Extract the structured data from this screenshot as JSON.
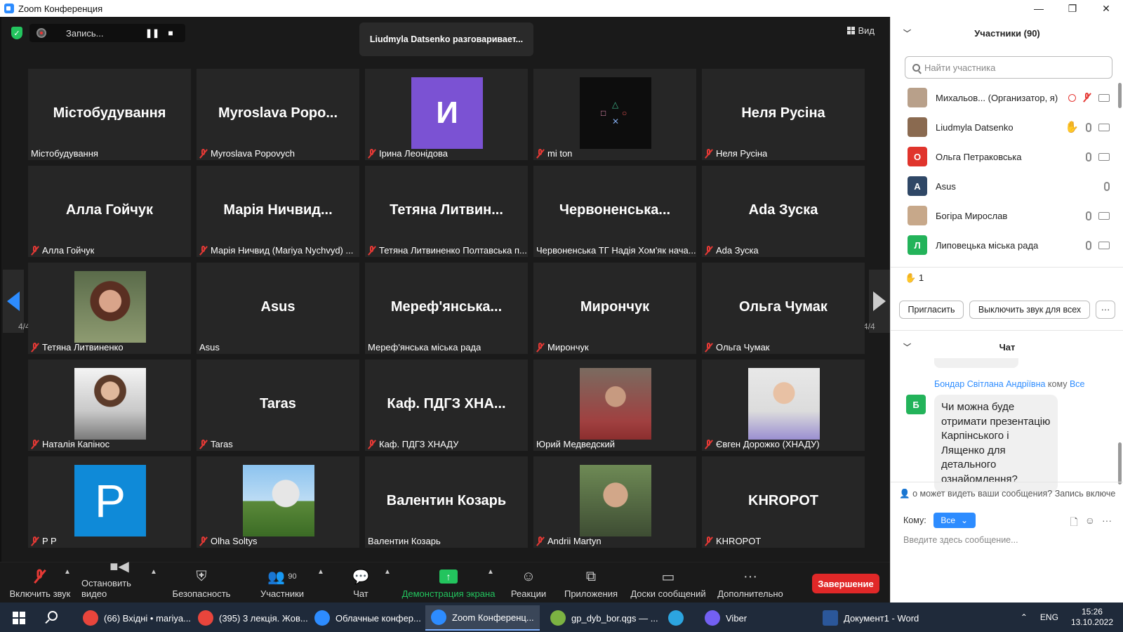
{
  "window": {
    "title": "Zoom Конференция",
    "minimize": "—",
    "restore": "❐",
    "close": "✕"
  },
  "meeting": {
    "recording_label": "Запись...",
    "pause": "❚❚",
    "stop": "■",
    "speaking_banner": "Liudmyla Datsenko разговаривает...",
    "view_label": "Вид",
    "page_left": "4/4",
    "page_right": "4/4",
    "tiles": [
      {
        "big": "Містобудування",
        "label": "Містобудування",
        "muted": false
      },
      {
        "big": "Myroslava  Popo...",
        "label": "Myroslava Popovych",
        "muted": true
      },
      {
        "avatar_letter": "И",
        "label": "Ірина Леонідова",
        "muted": true
      },
      {
        "label": "mi ton",
        "muted": true
      },
      {
        "big": "Неля Русіна",
        "label": "Неля Русіна",
        "muted": true
      },
      {
        "big": "Алла Гойчук",
        "label": "Алла Гойчук",
        "muted": true
      },
      {
        "big": "Марія  Ничвид...",
        "label": "Марія Ничвид (Mariya Nychvyd) ...",
        "muted": true
      },
      {
        "big": "Тетяна  Литвин...",
        "label": "Тетяна Литвиненко Полтавська п...",
        "muted": true
      },
      {
        "big": "Червоненська...",
        "label": "Червоненська ТГ Надія Хом'як нача...",
        "muted": false
      },
      {
        "big": "Ada Зуска",
        "label": "Ada Зуска",
        "muted": true
      },
      {
        "label": "Тетяна Литвиненко",
        "muted": true
      },
      {
        "big": "Asus",
        "label": "Asus",
        "muted": false
      },
      {
        "big": "Мереф'янська...",
        "label": "Мереф'янська міська рада",
        "muted": false
      },
      {
        "big": "Мирончук",
        "label": "Мирончук",
        "muted": true
      },
      {
        "big": "Ольга Чумак",
        "label": "Ольга Чумак",
        "muted": true
      },
      {
        "label": "Наталія Капінос",
        "muted": true
      },
      {
        "big": "Taras",
        "label": "Taras",
        "muted": true
      },
      {
        "big": "Каф.  ПДГЗ  ХНА...",
        "label": "Каф. ПДГЗ ХНАДУ",
        "muted": true
      },
      {
        "label": "Юрий Медведский",
        "muted": false
      },
      {
        "label": "Євген Дорожко (ХНАДУ)",
        "muted": true
      },
      {
        "avatar_letter": "P",
        "label": "P P",
        "muted": true
      },
      {
        "label": "Olha Soltys",
        "muted": true
      },
      {
        "big": "Валентин Козарь",
        "label": "Валентин Козарь",
        "muted": false
      },
      {
        "label": "Andrii Martyn",
        "muted": true
      },
      {
        "big": "KHROPOT",
        "label": "KHROPOT",
        "muted": true
      }
    ]
  },
  "toolbar": {
    "unmute": "Включить звук",
    "stop_video": "Остановить видео",
    "security": "Безопасность",
    "participants": "Участники",
    "participants_count": "90",
    "chat": "Чат",
    "share_screen": "Демонстрация экрана",
    "reactions": "Реакции",
    "apps": "Приложения",
    "whiteboards": "Доски сообщений",
    "more": "Дополнительно",
    "end": "Завершение"
  },
  "participants_panel": {
    "title": "Участники (90)",
    "search_placeholder": "Найти участника",
    "list": [
      {
        "initial": "",
        "name": "Михальов...  (Организатор, я)",
        "color": "#b8a08a"
      },
      {
        "initial": "",
        "name": "Liudmyla Datsenko",
        "color": "#8a6a50"
      },
      {
        "initial": "О",
        "name": "Ольга Петраковська",
        "color": "#e0342c"
      },
      {
        "initial": "A",
        "name": "Asus",
        "color": "#2f4766"
      },
      {
        "initial": "",
        "name": "Богіра Мирослав",
        "color": "#c7a88a"
      },
      {
        "initial": "Л",
        "name": "Липовецька міська рада",
        "color": "#23b35a"
      }
    ],
    "raised_hands": "1",
    "invite": "Пригласить",
    "mute_all": "Выключить звук для всех",
    "more": "···"
  },
  "chat_panel": {
    "title": "Чат",
    "sender": "Бондар Світлана Андріївна",
    "to_word": "кому",
    "recipient": "Все",
    "avatar_initial": "Б",
    "message": "Чи можна буде отримати презентацію Карпінського і Лященко для детального ознайомлення?",
    "who_can_see": "о может видеть ваши сообщения? Запись включе",
    "to_label": "Кому:",
    "to_value": "Все",
    "input_placeholder": "Введите здесь сообщение..."
  },
  "taskbar": {
    "tasks": [
      {
        "label": "(66) Вхідні • mariya...",
        "color": "#e8453c"
      },
      {
        "label": "(395) 3 лекція. Жов...",
        "color": "#e8453c"
      },
      {
        "label": "Облачные конфер...",
        "color": "#2d8cff"
      },
      {
        "label": "Zoom Конференц...",
        "color": "#2d8cff"
      },
      {
        "label": "gp_dyb_bor.qgs — ...",
        "color": "#7cb342"
      },
      {
        "label": "",
        "color": "#2ca5e0"
      },
      {
        "label": "Viber",
        "color": "#7360f2"
      },
      {
        "label": "Документ1 - Word",
        "color": "#2b579a"
      }
    ],
    "lang": "ENG",
    "time": "15:26",
    "date": "13.10.2022"
  }
}
